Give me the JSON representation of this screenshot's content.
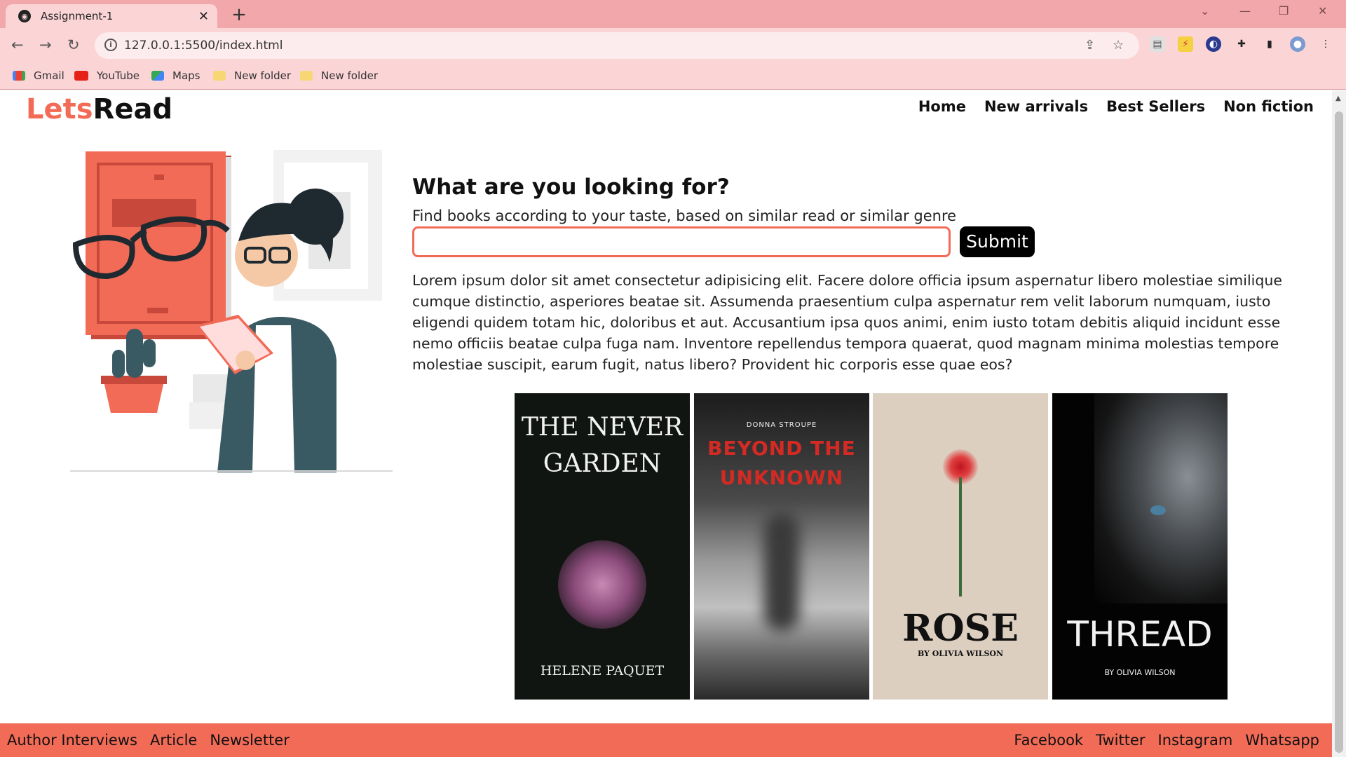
{
  "browser": {
    "tab_title": "Assignment-1",
    "url": "127.0.0.1:5500/index.html",
    "bookmarks": [
      "Gmail",
      "YouTube",
      "Maps",
      "New folder",
      "New folder"
    ]
  },
  "site": {
    "logo_part1": "Lets",
    "logo_part2": "Read",
    "nav": [
      "Home",
      "New arrivals",
      "Best Sellers",
      "Non fiction"
    ],
    "heading": "What are you looking for?",
    "subtext": "Find books according to your taste, based on similar read or similar genre",
    "search_value": "",
    "submit_label": "Submit",
    "lorem": "Lorem ipsum dolor sit amet consectetur adipisicing elit. Facere dolore officia ipsum aspernatur libero molestiae similique cumque distinctio, asperiores beatae sit. Assumenda praesentium culpa aspernatur rem velit laborum numquam, iusto eligendi quidem totam hic, doloribus et aut. Accusantium ipsa quos animi, enim iusto totam debitis aliquid incidunt esse nemo officiis beatae culpa fuga nam. Inventore repellendus tempora quaerat, quod magnam minima molestias tempore molestiae suscipit, earum fugit, natus libero? Provident hic corporis esse quae eos?",
    "books": [
      {
        "title1": "THE NEVER",
        "title2": "GARDEN",
        "author": "HELENE PAQUET"
      },
      {
        "author": "DONNA STROUPE",
        "title1": "BEYOND THE",
        "title2": "UNKNOWN"
      },
      {
        "title1": "ROSE",
        "author": "BY OLIVIA WILSON"
      },
      {
        "title1": "THREAD",
        "author": "BY OLIVIA WILSON"
      }
    ],
    "footer_left": [
      "Author Interviews",
      "Article",
      "Newsletter"
    ],
    "footer_right": [
      "Facebook",
      "Twitter",
      "Instagram",
      "Whatsapp"
    ]
  },
  "colors": {
    "accent": "#f26b57",
    "tabbar": "#f2a7aa",
    "toolbar": "#fbd4d6"
  }
}
